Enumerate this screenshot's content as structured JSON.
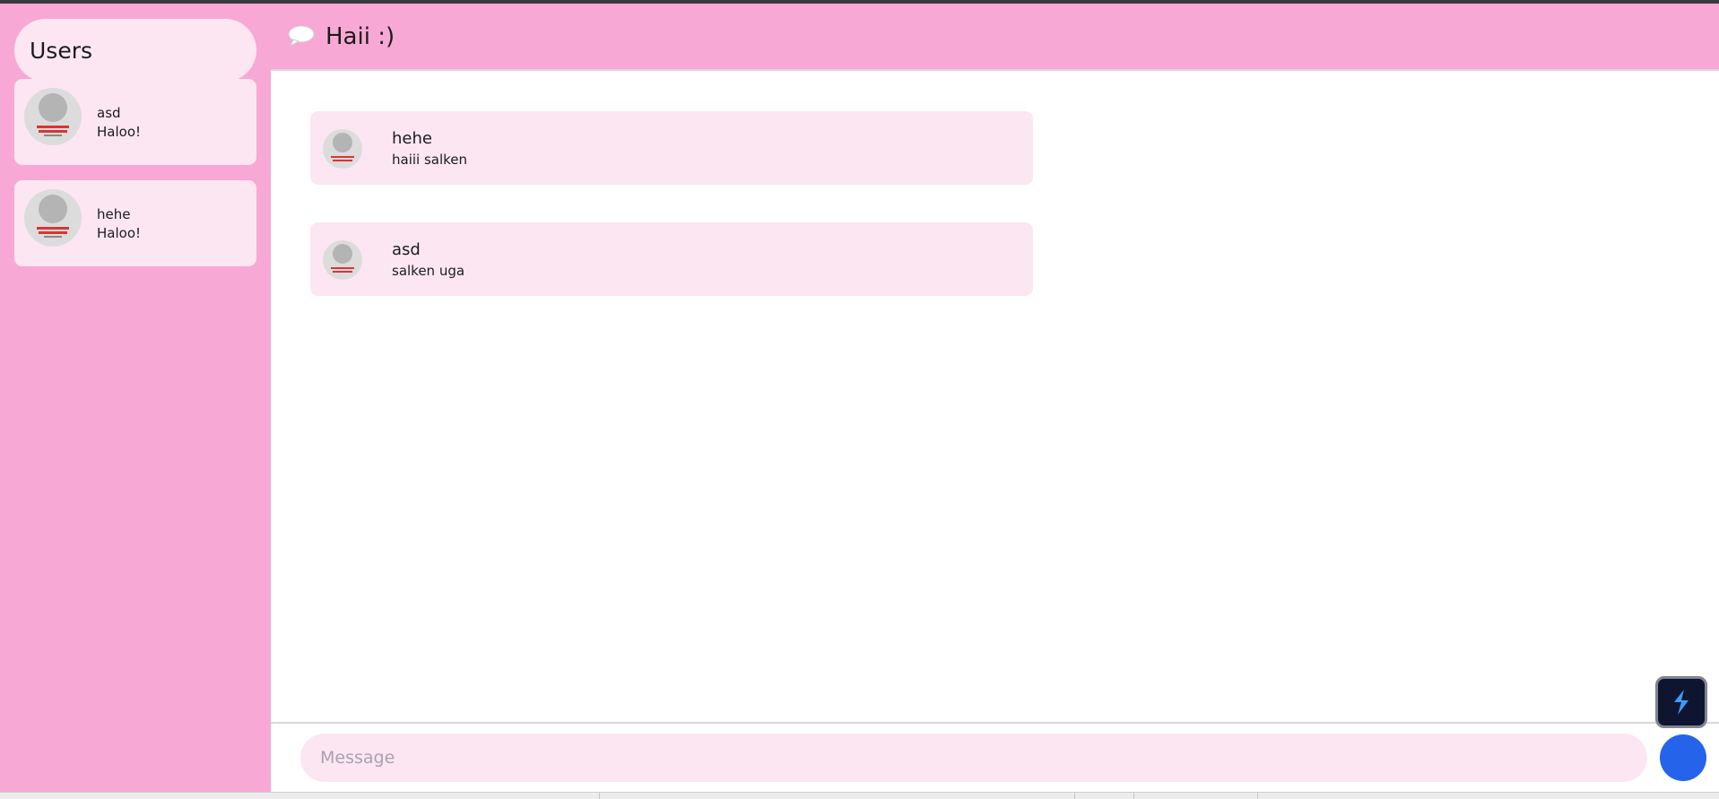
{
  "sidebar": {
    "title": "Users",
    "users": [
      {
        "name": "asd",
        "last_message": "Haloo!"
      },
      {
        "name": "hehe",
        "last_message": "Haloo!"
      }
    ]
  },
  "header": {
    "icon": "speech-bubble-icon",
    "title": "Haii :)"
  },
  "messages": [
    {
      "sender": "hehe",
      "text": "haiii salken"
    },
    {
      "sender": "asd",
      "text": "salken uga"
    }
  ],
  "composer": {
    "placeholder": "Message",
    "value": "",
    "send_icon": "send-button-circle"
  },
  "colors": {
    "pink": "#f8a8d5",
    "light_pink": "#fce6f2",
    "send_blue": "#2563eb",
    "extension_dark": "#0f1530"
  }
}
